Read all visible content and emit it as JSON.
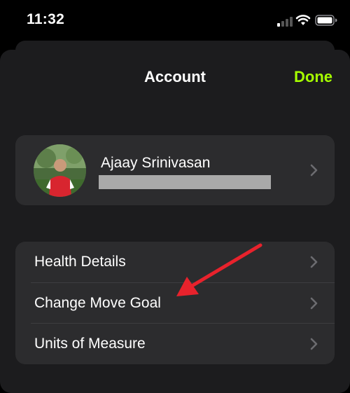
{
  "status_bar": {
    "time": "11:32"
  },
  "header": {
    "title": "Account",
    "done_label": "Done"
  },
  "profile": {
    "name": "Ajaay Srinivasan"
  },
  "settings": {
    "items": [
      {
        "label": "Health Details"
      },
      {
        "label": "Change Move Goal"
      },
      {
        "label": "Units of Measure"
      }
    ]
  },
  "colors": {
    "accent": "#a6ff00",
    "annotation_arrow": "#e8222c",
    "card": "#2c2c2e",
    "sheet": "#1c1c1e"
  },
  "icons": [
    "cellular-signal-icon",
    "wifi-icon",
    "battery-icon",
    "chevron-right-icon",
    "annotation-arrow"
  ]
}
